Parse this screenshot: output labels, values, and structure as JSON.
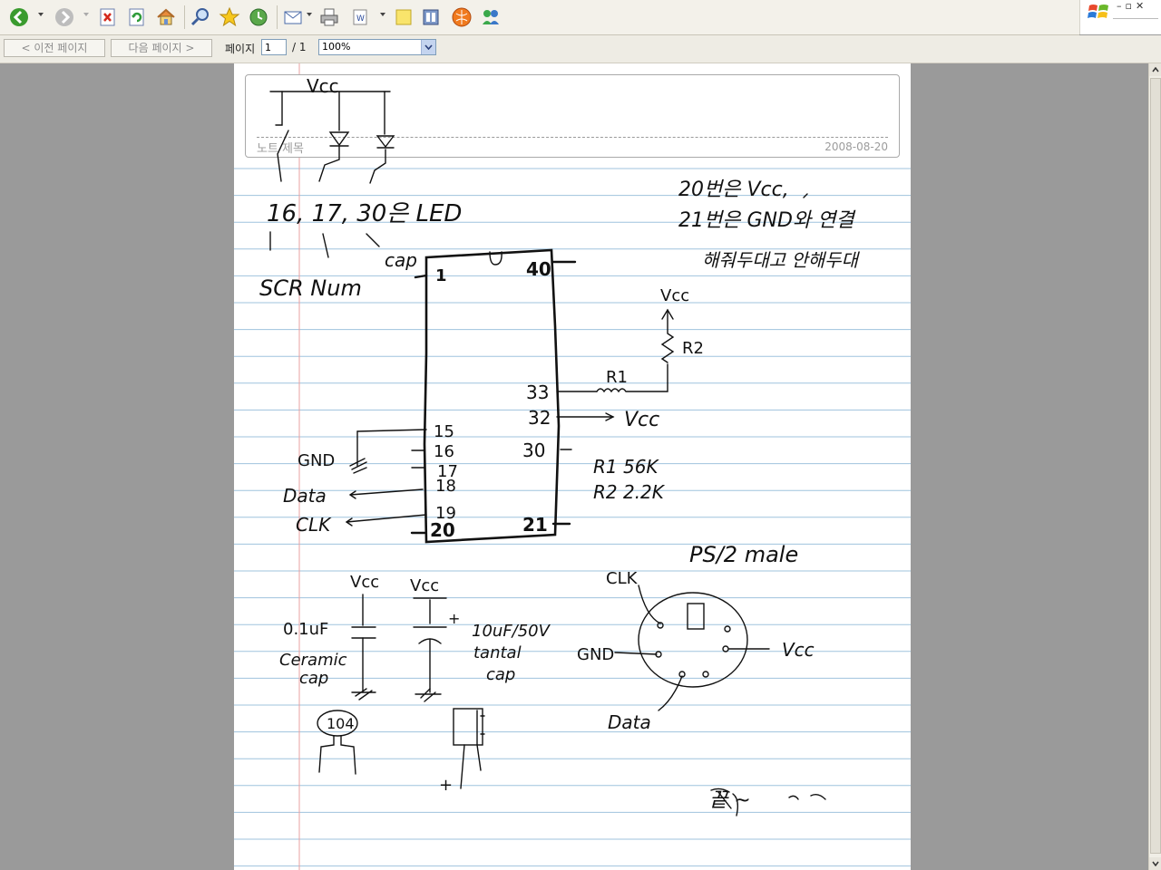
{
  "toolbar": {
    "icons": [
      "back-icon",
      "forward-icon",
      "stop-icon",
      "refresh-icon",
      "home-icon",
      "search-icon",
      "favorites-icon",
      "history-icon",
      "mail-icon",
      "print-icon",
      "edit-icon",
      "note-icon",
      "media-icon",
      "sun-icon",
      "messenger-icon"
    ]
  },
  "nav": {
    "prev_label": "< 이전 페이지",
    "next_label": "다음 페이지 >",
    "page_label": "페이지",
    "page_value": "1",
    "page_total": "/ 1",
    "zoom_value": "100%"
  },
  "note": {
    "title": "노트 제목",
    "date": "2008-08-20"
  },
  "sketch": {
    "vcc_top": "Vcc",
    "led_line": "16, 17, 30은 LED",
    "cap": "cap",
    "scr_num": "SCR  Num",
    "pin1": "1",
    "pin40": "40",
    "pin33": "33",
    "pin32": "32",
    "pin30": "30",
    "pin15": "15",
    "pin16": "16",
    "pin17": "17",
    "pin18": "18",
    "pin19": "19",
    "pin20": "20",
    "pin21": "21",
    "note1": "20번은 Vcc,",
    "note2": "21번은 GND와 연결",
    "note3": "해줘두대고 안해두대",
    "vcc_r2": "Vcc",
    "r2": "R2",
    "r1": "R1",
    "vcc_32": "Vcc",
    "gnd": "GND",
    "data": "Data",
    "clk": "CLK",
    "r1_val": "R1 56K",
    "r2_val": "R2 2.2K",
    "ps2": "PS/2  male",
    "clk_ps2": "CLK",
    "gnd_ps2": "GND",
    "vcc_ps2": "Vcc",
    "data_ps2": "Data",
    "vcc_c1": "Vcc",
    "vcc_c2": "Vcc",
    "c1_val": "0.1uF",
    "ceramic": "Ceramic",
    "cap_c1": "cap",
    "c2_val": "10uF/50V",
    "tantal": "tantal",
    "cap_c2": "cap",
    "plus1": "+",
    "code104": "104",
    "plus2": "+",
    "footer": "끝  ~"
  }
}
